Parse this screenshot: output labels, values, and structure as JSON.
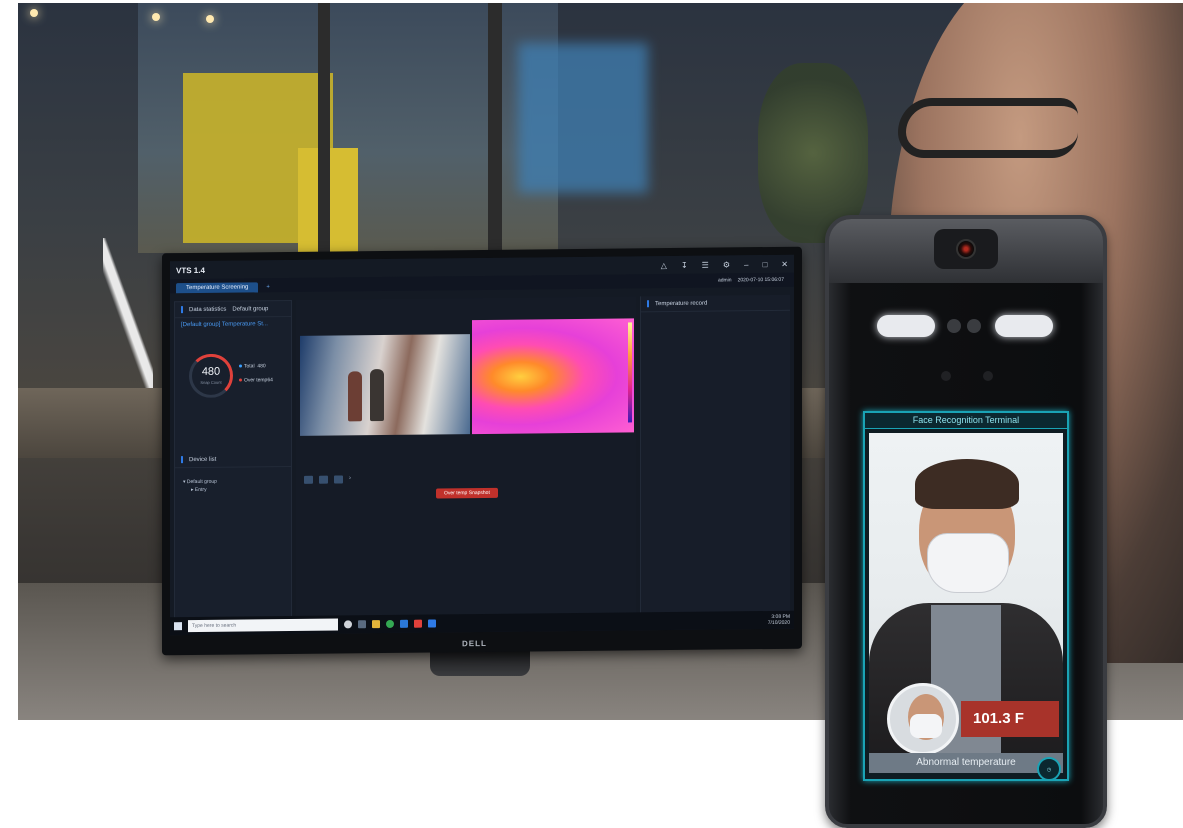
{
  "monitor": {
    "app_title": "VTS 1.4",
    "tab_label": "Temperature Screening",
    "user": "admin",
    "datetime": "2020-07-10 15:06:07",
    "data_statistics_label": "Data statistics",
    "group_select": "Default group",
    "group_title": "[Default group] Temperature St...",
    "snap_count_value": "480",
    "snap_count_label": "Snap Count",
    "total_label": "Total",
    "total_value": "480",
    "over_temp_label": "Over temp",
    "over_temp_value": "64",
    "device_list_label": "Device list",
    "tree_root": "Default group",
    "tree_child": "Entry",
    "temperature_record_label": "Temperature record",
    "snapshot_label": "Over temp Snapshot",
    "search_placeholder": "Type here to search",
    "clock_time": "3:08 PM",
    "clock_date": "7/10/2020",
    "brand": "DELL",
    "colors": {
      "accent": "#2e7ae6",
      "alert": "#c0312b"
    }
  },
  "terminal": {
    "header": "Face Recognition Terminal",
    "temperature": "101.3 F",
    "status": "Abnormal temperature",
    "colors": {
      "frame": "#1aa3b5",
      "badge": "#a8332a"
    }
  }
}
